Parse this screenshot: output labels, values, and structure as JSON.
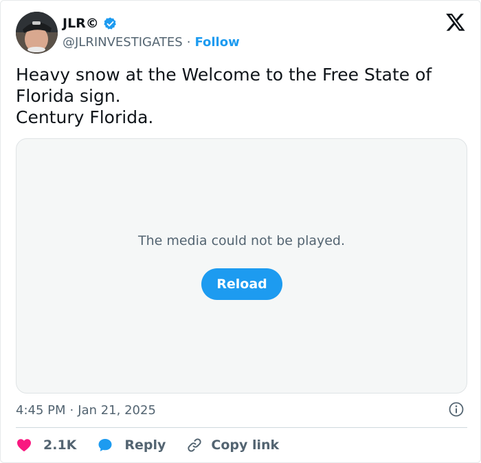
{
  "author": {
    "display_name": "JLR©",
    "handle": "@JLRINVESTIGATES",
    "separator": "·",
    "follow_label": "Follow"
  },
  "tweet": {
    "lines": [
      "Heavy snow at the Welcome to the Free State of",
      "Florida sign.",
      "Century Florida."
    ]
  },
  "media": {
    "message": "The media could not be played.",
    "reload_label": "Reload"
  },
  "meta": {
    "time": "4:45 PM",
    "separator": "·",
    "date": "Jan 21, 2025"
  },
  "actions": {
    "likes": "2.1K",
    "reply_label": "Reply",
    "copy_link_label": "Copy link"
  },
  "colors": {
    "accent": "#1d9bf0",
    "like": "#f91880",
    "muted": "#536471"
  },
  "icons": {
    "verified": "verified-badge-icon",
    "x_logo": "x-logo-icon",
    "info": "info-icon",
    "like": "heart-icon",
    "reply": "speech-bubble-icon",
    "copy": "link-icon"
  }
}
